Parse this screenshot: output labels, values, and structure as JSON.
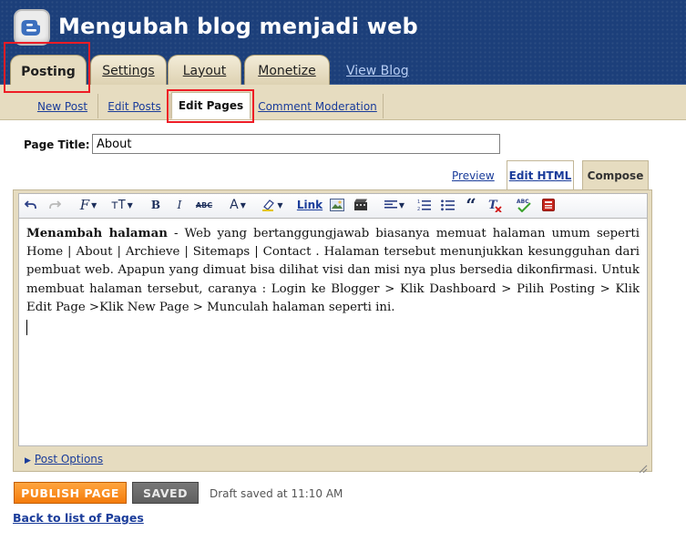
{
  "header": {
    "blog_title": "Mengubah blog menjadi web",
    "logo_icon": "blogger-logo-icon"
  },
  "tabs": [
    {
      "label": "Posting",
      "active": true
    },
    {
      "label": "Settings",
      "active": false
    },
    {
      "label": "Layout",
      "active": false
    },
    {
      "label": "Monetize",
      "active": false
    }
  ],
  "view_blog_label": "View Blog",
  "subnav": [
    {
      "label": "New Post",
      "active": false
    },
    {
      "label": "Edit Posts",
      "active": false
    },
    {
      "label": "Edit Pages",
      "active": true
    },
    {
      "label": "Comment Moderation",
      "active": false
    }
  ],
  "form": {
    "page_title_label": "Page Title:",
    "page_title_value": "About"
  },
  "editor_modes": {
    "preview": "Preview",
    "edit_html": "Edit HTML",
    "compose": "Compose",
    "active": "Compose"
  },
  "toolbar": {
    "link_label": "Link",
    "items": [
      "undo-icon",
      "redo-icon",
      "font-family-icon",
      "font-size-icon",
      "bold-icon",
      "italic-icon",
      "strikethrough-icon",
      "text-color-icon",
      "highlight-color-icon",
      "link",
      "image-icon",
      "video-icon",
      "align-icon",
      "numbered-list-icon",
      "bulleted-list-icon",
      "blockquote-icon",
      "remove-formatting-icon",
      "spellcheck-icon",
      "jump-break-icon"
    ]
  },
  "content": {
    "bold_lead": "Menambah halaman",
    "body": " - Web yang bertanggungjawab biasanya memuat halaman umum seperti Home | About | Archieve | Sitemaps | Contact . Halaman tersebut menunjukkan kesungguhan dari pembuat web. Apapun yang dimuat bisa dilihat visi dan misi nya plus bersedia dikonfirmasi. Untuk membuat halaman tersebut, caranya : Login ke Blogger > Klik Dashboard > Pilih Posting > Klik Edit Page >Klik New Page > Munculah halaman seperti ini."
  },
  "post_options_label": "Post Options",
  "actions": {
    "publish": "PUBLISH PAGE",
    "saved": "SAVED",
    "draft_status": "Draft saved at 11:10 AM",
    "back_link": "Back to list of Pages"
  },
  "colors": {
    "header_bg": "#1c3f7a",
    "tab_bg": "#e6dcc0",
    "link": "#1a3c9a",
    "publish": "#f47c0b",
    "highlight_box": "#ee1c25"
  }
}
